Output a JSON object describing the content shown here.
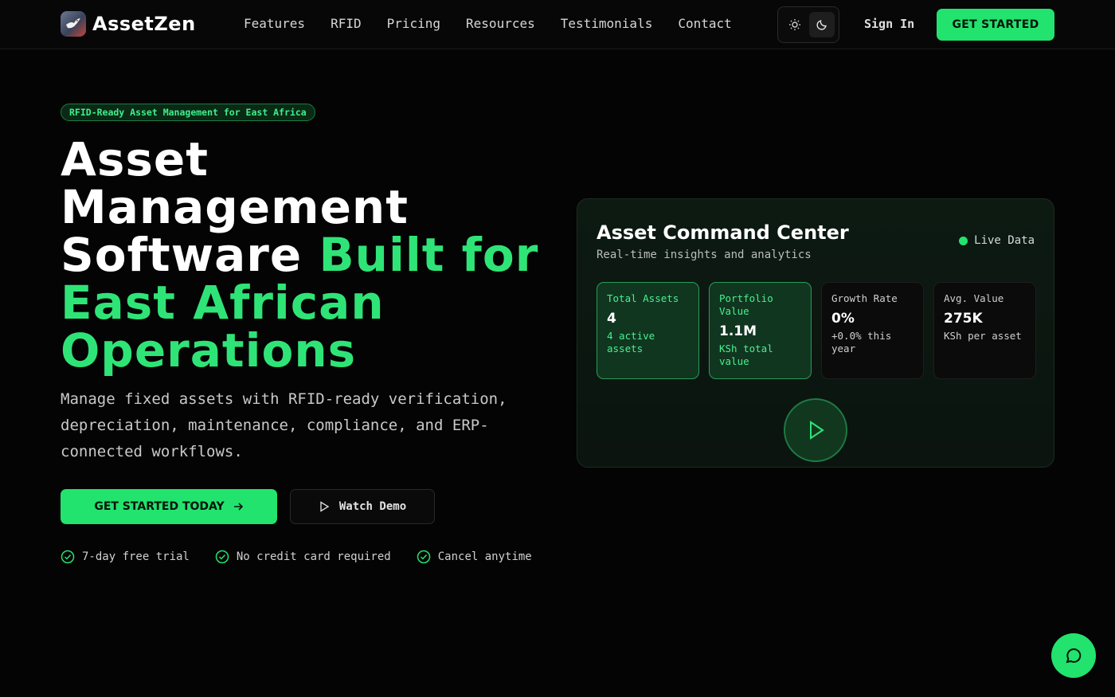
{
  "brand": {
    "name": "AssetZen"
  },
  "nav": {
    "links": [
      "Features",
      "RFID",
      "Pricing",
      "Resources",
      "Testimonials",
      "Contact"
    ],
    "sign_in": "Sign In",
    "cta": "GET STARTED"
  },
  "hero": {
    "tagline": "RFID-Ready Asset Management for East Africa",
    "headline_white": "Asset Management Software",
    "headline_green": "Built for East African Operations",
    "subtext": "Manage fixed assets with RFID-ready verification, depreciation, maintenance, compliance, and ERP-connected workflows.",
    "primary_cta": "GET STARTED TODAY",
    "secondary_cta": "Watch Demo",
    "perks": [
      "7-day free trial",
      "No credit card required",
      "Cancel anytime"
    ]
  },
  "dashboard": {
    "title": "Asset Command Center",
    "subtitle": "Real-time insights and analytics",
    "live_label": "Live Data",
    "stats": [
      {
        "label": "Total Assets",
        "value": "4",
        "note": "4 active assets"
      },
      {
        "label": "Portfolio Value",
        "value": "1.1M",
        "note": "KSh total value"
      },
      {
        "label": "Growth Rate",
        "value": "0%",
        "note": "+0.0% this year"
      },
      {
        "label": "Avg. Value",
        "value": "275K",
        "note": "KSh per asset"
      }
    ]
  },
  "icons": {
    "theme_light": "sun-icon",
    "theme_dark": "moon-icon",
    "arrow": "arrow-right-icon",
    "play": "play-icon",
    "check": "check-circle-icon",
    "chat": "chat-bubble-icon"
  },
  "colors": {
    "accent": "#22e36d",
    "background": "#040404",
    "card": "#0c1a12"
  }
}
